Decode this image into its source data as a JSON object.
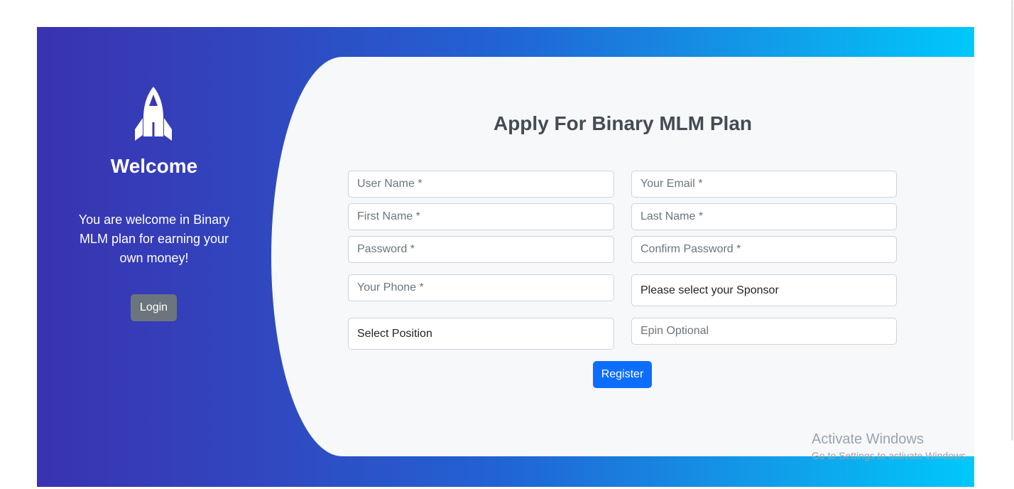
{
  "left_panel": {
    "title": "Welcome",
    "message": "You are welcome in Binary MLM plan for earning your own money!",
    "login_label": "Login",
    "icon": "rocket-icon"
  },
  "form": {
    "heading": "Apply For Binary MLM Plan",
    "fields": {
      "username": "User Name *",
      "email": "Your Email *",
      "first_name": "First Name *",
      "last_name": "Last Name *",
      "password": "Password *",
      "confirm_password": "Confirm Password *",
      "phone": "Your Phone *",
      "epin": "Epin Optional"
    },
    "sponsor_select": "Please select your Sponsor",
    "position_select": "Select Position",
    "register_label": "Register"
  },
  "watermark": {
    "title": "Activate Windows",
    "subtitle": "Go to Settings to activate Windows."
  },
  "colors": {
    "gradient_start": "#3a32b0",
    "gradient_end": "#00c8fb",
    "register_button": "#0d6efd",
    "login_button": "#6c757d",
    "card_background": "#f7f8fa"
  }
}
